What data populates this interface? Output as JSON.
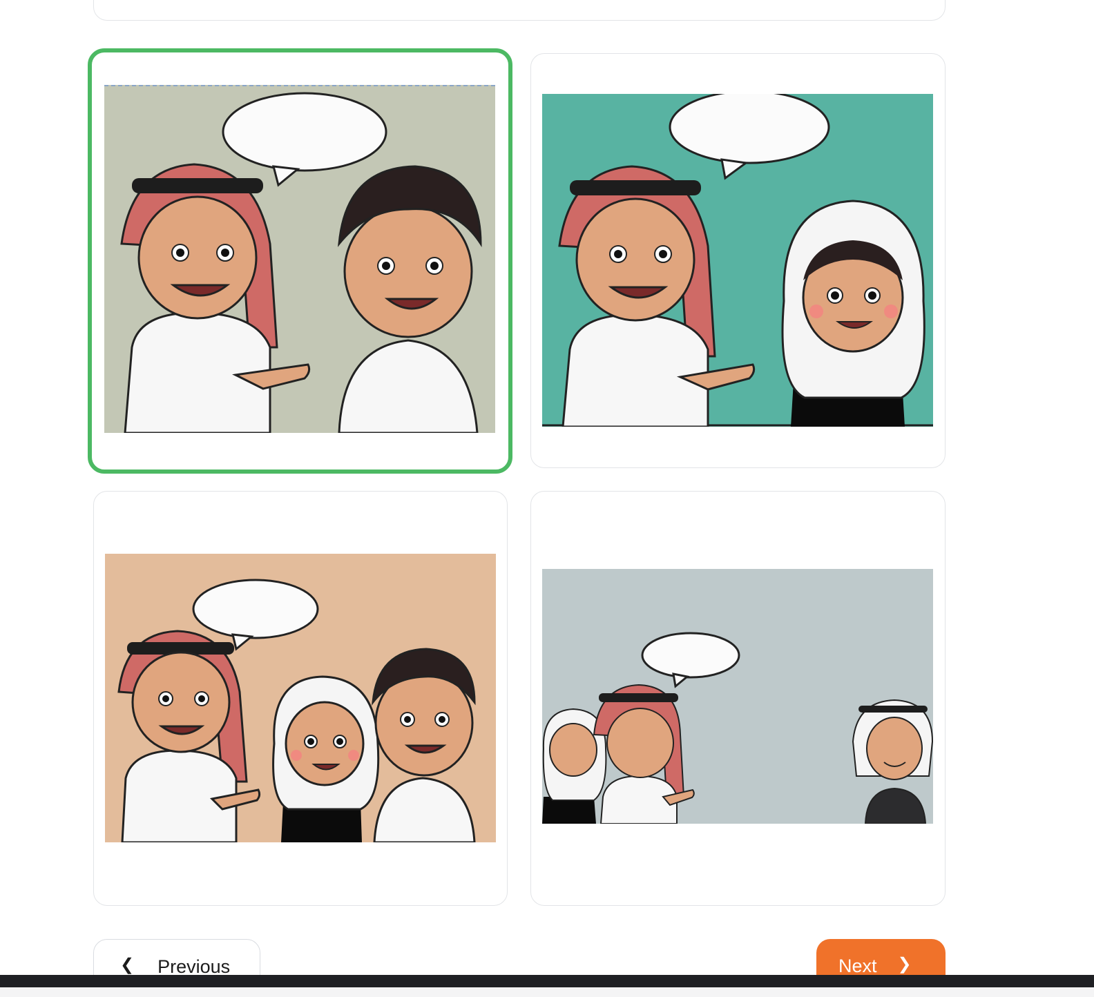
{
  "options": [
    {
      "id": "option-1",
      "selected": true,
      "scene": "boy-ghutra-and-boy",
      "background": "#c3c7b5"
    },
    {
      "id": "option-2",
      "selected": false,
      "scene": "boy-ghutra-and-girl-hijab",
      "background": "#58b3a2"
    },
    {
      "id": "option-3",
      "selected": false,
      "scene": "boy-ghutra-girl-and-boy",
      "background": "#e3bc9b"
    },
    {
      "id": "option-4",
      "selected": false,
      "scene": "group-small-with-boy-far",
      "background": "#bec9cb"
    }
  ],
  "navigation": {
    "previous_label": "Previous",
    "previous_icon": "chevron-left-icon",
    "next_label": "Next",
    "next_icon": "chevron-right-icon",
    "next_color": "#f0722a"
  },
  "selection_color": "#4cb963"
}
